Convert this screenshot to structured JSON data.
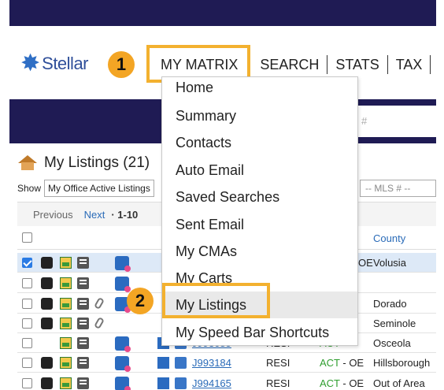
{
  "logo": {
    "text": "Stellar"
  },
  "nav": {
    "items": [
      "MY MATRIX",
      "SEARCH",
      "STATS",
      "TAX"
    ]
  },
  "steps": {
    "one": "1",
    "two": "2"
  },
  "search": {
    "placeholder": "#"
  },
  "listings": {
    "title": "My Listings (21)",
    "show_label": "Show",
    "show_value": "My Office Active Listings",
    "mls_placeholder": "-- MLS # --"
  },
  "pager": {
    "previous": "Previous",
    "next": "Next",
    "range": "· 1-10"
  },
  "grid": {
    "county_header": "County",
    "rows": [
      {
        "checked": true,
        "mls": "",
        "type": "",
        "status": "",
        "status_suffix": "OE",
        "county": "Volusia"
      },
      {
        "checked": false,
        "mls": "",
        "type": "",
        "status": "",
        "status_suffix": "",
        "county": ""
      },
      {
        "checked": false,
        "mls": "",
        "type": "",
        "status": "",
        "status_suffix": "",
        "county": "Dorado"
      },
      {
        "checked": false,
        "mls": "",
        "type": "",
        "status": "",
        "status_suffix": "",
        "county": "Seminole"
      },
      {
        "checked": false,
        "mls": "J993085",
        "type": "RESI",
        "status": "ACT",
        "status_suffix": "",
        "county": "Osceola"
      },
      {
        "checked": false,
        "mls": "J993184",
        "type": "RESI",
        "status": "ACT",
        "status_suffix": "- OE",
        "county": "Hillsborough"
      },
      {
        "checked": false,
        "mls": "J994165",
        "type": "RESI",
        "status": "ACT",
        "status_suffix": "- OE",
        "county": "Out of Area"
      }
    ]
  },
  "dropdown": {
    "items": [
      "Home",
      "Summary",
      "Contacts",
      "Auto Email",
      "Saved Searches",
      "Sent Email",
      "My CMAs",
      "My Carts",
      "My Listings",
      "My Speed Bar Shortcuts"
    ]
  },
  "colors": {
    "navy": "#1f1b54",
    "highlight": "#f3b12f",
    "badge": "#f3a524",
    "link": "#2a6bb8"
  }
}
